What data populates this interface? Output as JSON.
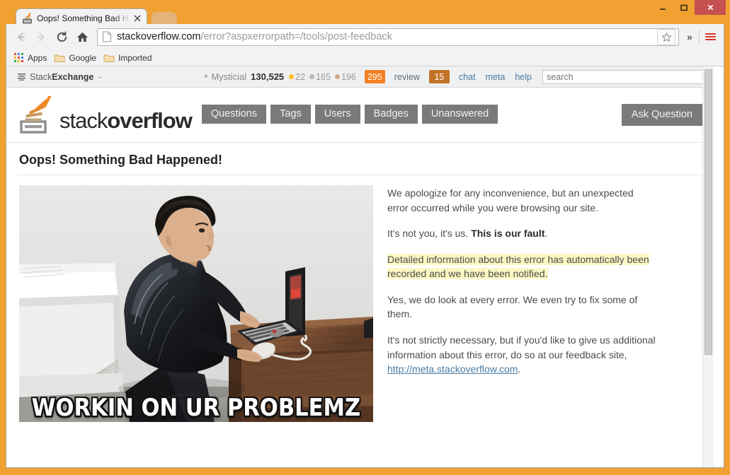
{
  "window": {
    "minimize_label": "Minimize",
    "maximize_label": "Maximize",
    "close_label": "Close",
    "frame_color": "#f0a132"
  },
  "browser": {
    "tab": {
      "title": "Oops! Something Bad Hap",
      "close_label": "×",
      "favicon": "stackoverflow-favicon"
    },
    "new_tab_label": "New Tab",
    "toolbar": {
      "back_label": "Back",
      "forward_label": "Forward",
      "reload_label": "Reload",
      "home_label": "Home",
      "url_host": "stackoverflow.com",
      "url_path": "/error?aspxerrorpath=/tools/post-feedback",
      "bookmark_label": "Bookmark this page",
      "overflow_label": "»",
      "menu_label": "Customize and control Google Chrome"
    },
    "bookmarks": [
      {
        "label": "Apps",
        "icon": "apps-grid-icon"
      },
      {
        "label": "Google",
        "icon": "folder-icon"
      },
      {
        "label": "Imported",
        "icon": "folder-icon"
      }
    ]
  },
  "se_topbar": {
    "network_label_1": "Stack",
    "network_label_2": "Exchange",
    "network_caret": "⌄",
    "user_caret": "▾",
    "username": "Mysticial",
    "reputation": "130,525",
    "badges": [
      {
        "count": "22",
        "color": "#fcc21b"
      },
      {
        "count": "165",
        "color": "#b4b8bc"
      },
      {
        "count": "196",
        "color": "#d1a684"
      }
    ],
    "review_count": "295",
    "review_count_color": "#f48024",
    "review_label": "review",
    "inbox_count": "15",
    "inbox_count_color": "#c27327",
    "chat_label": "chat",
    "meta_label": "meta",
    "help_label": "help",
    "search_placeholder": "search"
  },
  "site_header": {
    "logo_text_1": "stack",
    "logo_text_2": "overflow",
    "nav": [
      {
        "label": "Questions"
      },
      {
        "label": "Tags"
      },
      {
        "label": "Users"
      },
      {
        "label": "Badges"
      },
      {
        "label": "Unanswered"
      }
    ],
    "ask_button": "Ask Question"
  },
  "error_page": {
    "title": "Oops! Something Bad Happened!",
    "paragraph_1": "We apologize for any inconvenience, but an unexpected error occurred while you were browsing our site.",
    "paragraph_2_lead": "It's not you, it's us. ",
    "paragraph_2_bold": "This is our fault",
    "paragraph_2_tail": ".",
    "highlighted": "Detailed information about this error has automatically been recorded and we have been notified.",
    "paragraph_3": "Yes, we do look at every error. We even try to fix some of them.",
    "paragraph_4_lead": "It's not strictly necessary, but if you'd like to give us additional information about this error, do so at our feedback site, ",
    "paragraph_4_link": "http://meta.stackoverflow.com",
    "paragraph_4_tail": ".",
    "highlight_color": "#fcf8c3",
    "link_color": "#4a7ba1",
    "image": {
      "alt": "Man crouching at a wooden desk typing on a laptop",
      "caption": "WORKIN ON UR PROBLEMZ"
    }
  }
}
